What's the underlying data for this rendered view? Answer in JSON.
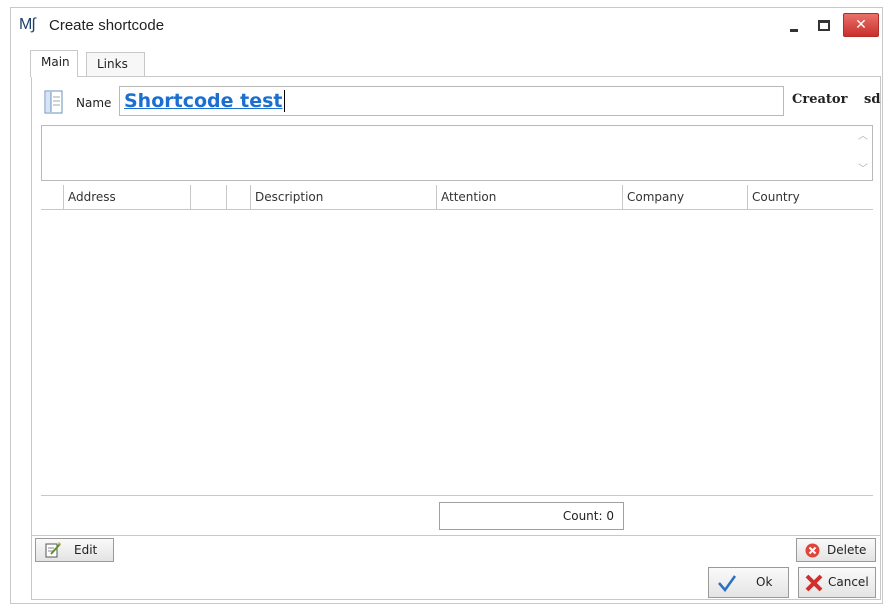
{
  "window": {
    "logo_text": "M∫",
    "title": "Create shortcode",
    "close_glyph": "✕",
    "icons": {
      "minimize": "minimize-icon",
      "maximize": "maximize-icon",
      "close": "close-icon"
    }
  },
  "tabs": [
    {
      "label": "Main",
      "active": true
    },
    {
      "label": "Links",
      "active": false
    }
  ],
  "form": {
    "name_label": "Name",
    "name_value": "Shortcode test",
    "creator_label": "Creator",
    "creator_value": "sd",
    "description_value": ""
  },
  "grid": {
    "columns": [
      "Address",
      "",
      "",
      "Description",
      "Attention",
      "Company",
      "Country"
    ],
    "rows": [],
    "count_label": "Count: 0"
  },
  "buttons": {
    "edit": "Edit",
    "delete": "Delete",
    "ok": "Ok",
    "cancel": "Cancel"
  },
  "colors": {
    "accent_link": "#1b6fd1",
    "close_button": "#d9534f",
    "ok_check": "#2d6fc1",
    "cancel_x": "#d22e2e",
    "delete_icon": "#e0453b"
  }
}
